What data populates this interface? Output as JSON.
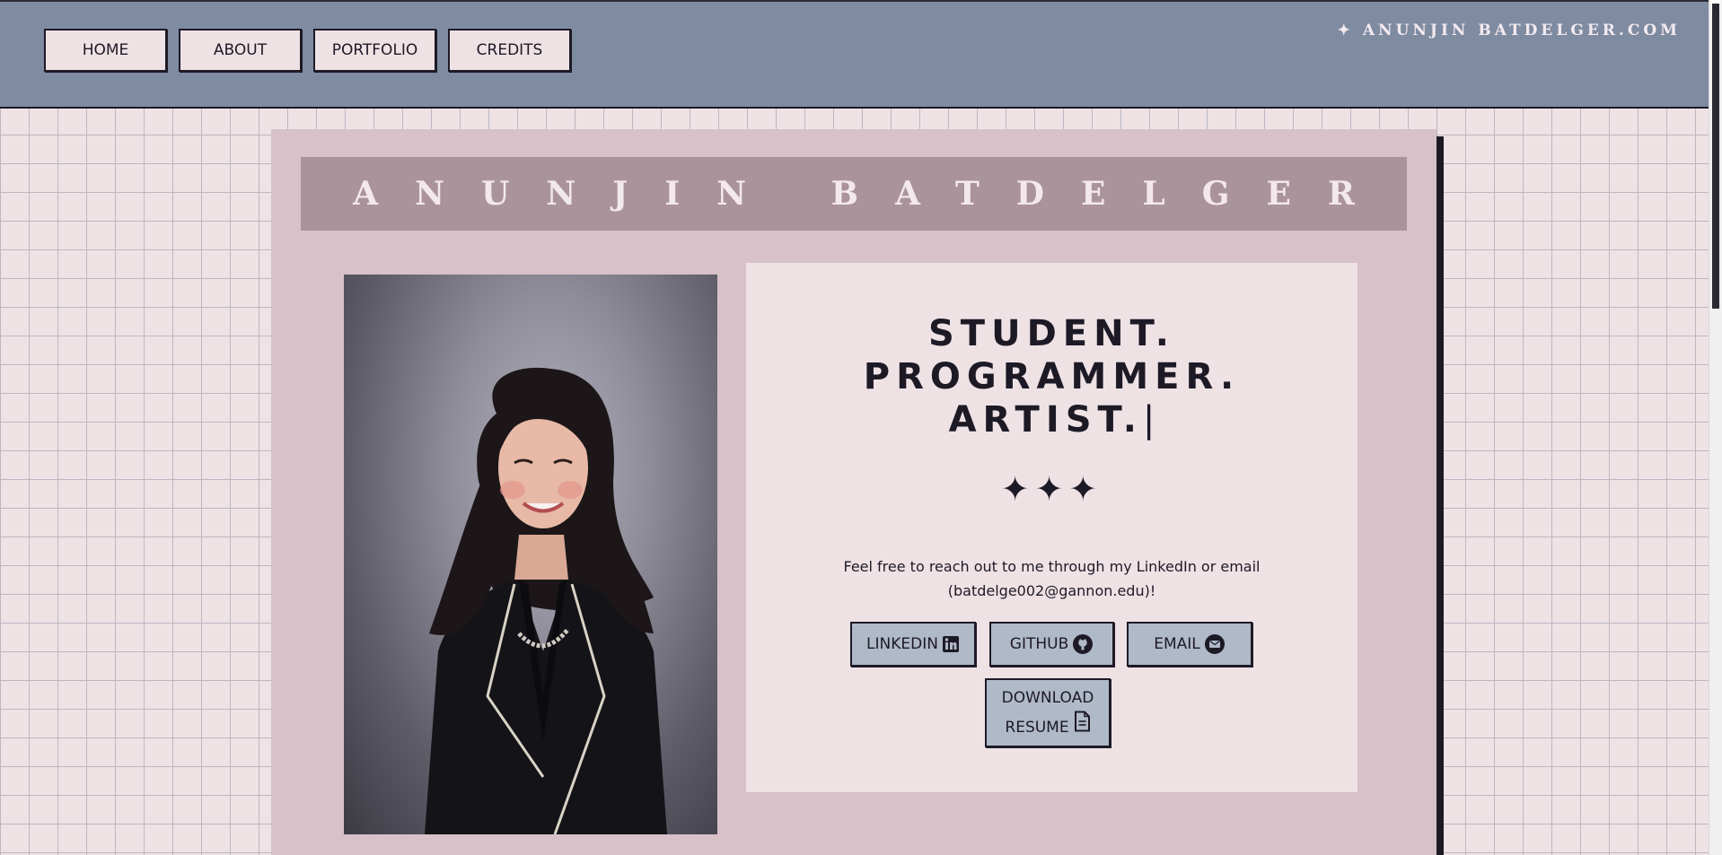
{
  "nav": {
    "items": [
      {
        "label": "HOME"
      },
      {
        "label": "ABOUT"
      },
      {
        "label": "PORTFOLIO"
      },
      {
        "label": "CREDITS"
      }
    ],
    "brand": "✦ ANUNJIN BATDELGER.COM"
  },
  "hero": {
    "name_banner": "ANUNJIN BATDELGER",
    "headline": {
      "line1": "STUDENT.",
      "line2": "PROGRAMMER.",
      "line3": "ARTIST.",
      "cursor": "|"
    },
    "sparkles": "✦✦✦",
    "blurb": "Feel free to reach out to me through my LinkedIn or email (batdelge002@gannon.edu)!",
    "buttons": {
      "linkedin": "LINKEDIN",
      "github": "GITHUB",
      "email": "EMAIL",
      "resume_line1": "DOWNLOAD",
      "resume_line2": "RESUME"
    }
  },
  "icons": {
    "linkedin": "linkedin-icon",
    "github": "github-icon",
    "email": "mail-icon",
    "resume": "document-icon"
  },
  "colors": {
    "topbar": "#7f8ba1",
    "background": "#efe2e5",
    "card": "#d8c1c9",
    "banner": "#ab939b",
    "button": "#b0b9c8",
    "ink": "#1d1a26"
  }
}
